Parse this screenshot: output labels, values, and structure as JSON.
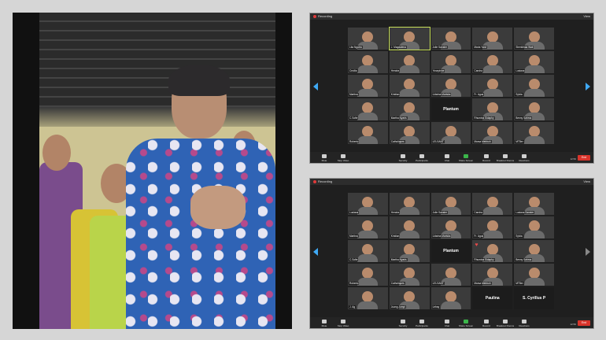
{
  "zoom_top": {
    "recording": "Recording",
    "view": "View",
    "tiles": [
      {
        "name": "Lita Ngutra",
        "kind": "video"
      },
      {
        "name": "J. Magdalena",
        "kind": "video",
        "active": true
      },
      {
        "name": "Jolie Sanster",
        "kind": "video"
      },
      {
        "name": "Maria Yarvi",
        "kind": "video"
      },
      {
        "name": "Shenikhaa Wati",
        "kind": "video"
      },
      {
        "name": "Cecilia",
        "kind": "video"
      },
      {
        "name": "Hendra",
        "kind": "video"
      },
      {
        "name": "Yosephine",
        "kind": "video"
      },
      {
        "name": "Candra",
        "kind": "video"
      },
      {
        "name": "Lusiana",
        "kind": "video"
      },
      {
        "name": "Martina",
        "kind": "video"
      },
      {
        "name": "Kristian",
        "kind": "video"
      },
      {
        "name": "Lidwina Mariska",
        "kind": "video"
      },
      {
        "name": "Fr. Agus",
        "kind": "video"
      },
      {
        "name": "Sylvia",
        "kind": "video"
      },
      {
        "name": "C.Sofie",
        "kind": "video"
      },
      {
        "name": "Martha Nyaris",
        "kind": "video"
      },
      {
        "name": "Plantum",
        "kind": "label"
      },
      {
        "name": "Rhumina Sidaphy",
        "kind": "video"
      },
      {
        "name": "Benny Sahma",
        "kind": "video"
      },
      {
        "name": "Roberto",
        "kind": "video"
      },
      {
        "name": "Catholiques",
        "kind": "video"
      },
      {
        "name": "LELSANT",
        "kind": "video"
      },
      {
        "name": "Marsa Mebbuh",
        "kind": "video"
      },
      {
        "name": "MTBer",
        "kind": "video"
      }
    ],
    "toolbar": [
      "Mute",
      "Stop Video",
      "Security",
      "Participants",
      "Chat",
      "Share Screen",
      "Record",
      "Breakout Rooms",
      "Reactions"
    ],
    "time": "12:50",
    "end": "End"
  },
  "zoom_bottom": {
    "recording": "Recording",
    "view": "View",
    "tiles": [
      {
        "name": "Lusiana",
        "kind": "video"
      },
      {
        "name": "Hendra",
        "kind": "video"
      },
      {
        "name": "Jolie Sanster",
        "kind": "video"
      },
      {
        "name": "Candra",
        "kind": "video"
      },
      {
        "name": "Lusiana Sanster",
        "kind": "video"
      },
      {
        "name": "Martina",
        "kind": "video"
      },
      {
        "name": "Kristian",
        "kind": "video"
      },
      {
        "name": "Lidwina Mariska",
        "kind": "video"
      },
      {
        "name": "Fr. Agus",
        "kind": "video"
      },
      {
        "name": "Sylvia",
        "kind": "video"
      },
      {
        "name": "C.Sofie",
        "kind": "video"
      },
      {
        "name": "Martha Nyaris",
        "kind": "video"
      },
      {
        "name": "Plantum",
        "kind": "label"
      },
      {
        "name": "Rhumina Sidaphy",
        "kind": "video",
        "heart": true
      },
      {
        "name": "Benny Sahma",
        "kind": "video"
      },
      {
        "name": "Roberto",
        "kind": "video"
      },
      {
        "name": "Catholiques",
        "kind": "video"
      },
      {
        "name": "LELSANT",
        "kind": "video"
      },
      {
        "name": "Marsa Mebbuh",
        "kind": "video"
      },
      {
        "name": "MTBer",
        "kind": "video"
      },
      {
        "name": "J. Ag",
        "kind": "video"
      },
      {
        "name": "Juang Jumpi",
        "kind": "video"
      },
      {
        "name": "Lehay",
        "kind": "video"
      },
      {
        "name": "Paulina",
        "kind": "label"
      },
      {
        "name": "S. Cyrillus P",
        "kind": "label"
      }
    ],
    "toolbar": [
      "Mute",
      "Stop Video",
      "Security",
      "Participants",
      "Chat",
      "Share Screen",
      "Record",
      "Breakout Rooms",
      "Reactions"
    ],
    "time": "12:50",
    "end": "End"
  },
  "colors": {
    "accent": "#3fa9f5",
    "end": "#d9342b",
    "active_speaker": "#c8e05a"
  }
}
